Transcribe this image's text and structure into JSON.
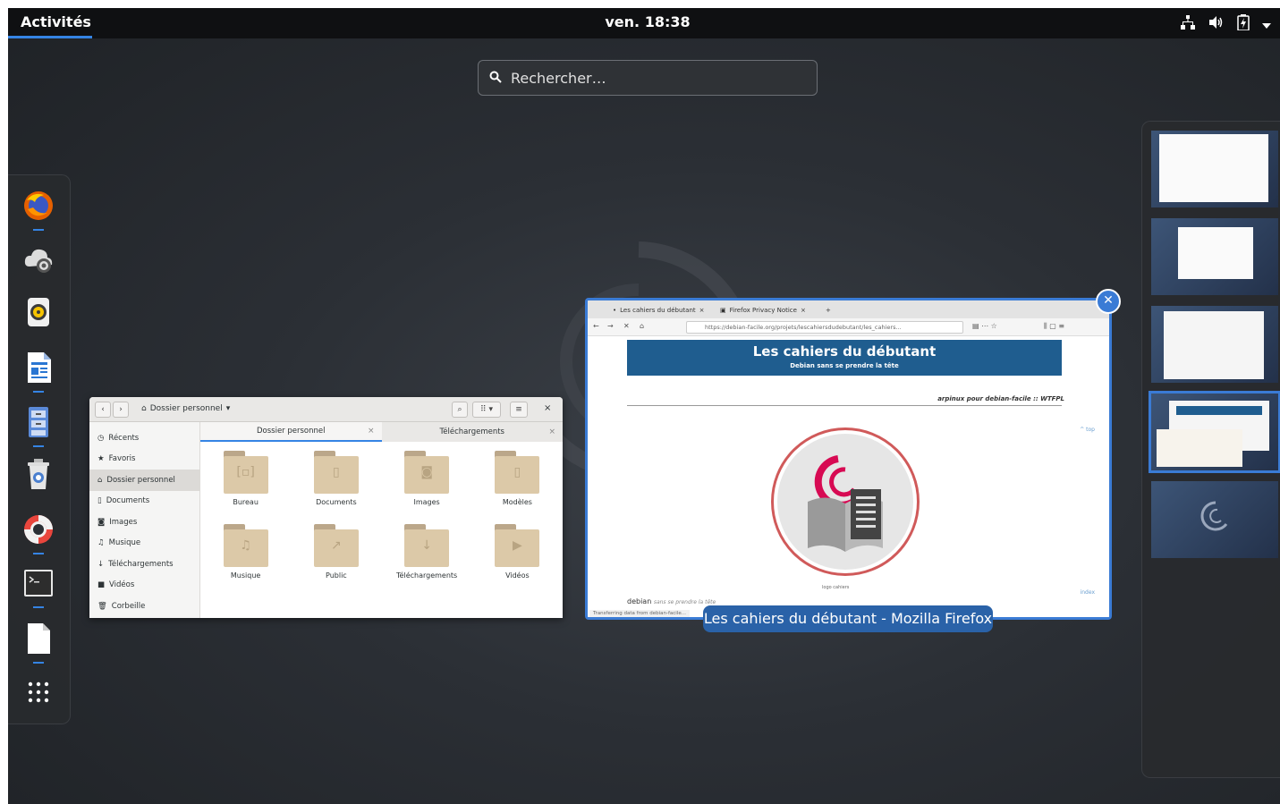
{
  "topbar": {
    "activities": "Activités",
    "clock": "ven. 18:38",
    "tray_icons": [
      "network-icon",
      "volume-icon",
      "battery-icon",
      "system-menu-arrow-icon"
    ]
  },
  "search": {
    "placeholder": "Rechercher…"
  },
  "dash": {
    "apps": [
      {
        "name": "Firefox",
        "icon": "firefox-icon",
        "running": true
      },
      {
        "name": "Software Updates",
        "icon": "software-update-icon",
        "running": false
      },
      {
        "name": "Rhythmbox",
        "icon": "rhythmbox-icon",
        "running": false
      },
      {
        "name": "LibreOffice Writer",
        "icon": "writer-icon",
        "running": true
      },
      {
        "name": "File Cabinet",
        "icon": "file-cabinet-icon",
        "running": true
      },
      {
        "name": "Trash Manager",
        "icon": "trash-app-icon",
        "running": false
      },
      {
        "name": "Help",
        "icon": "help-icon",
        "running": true
      },
      {
        "name": "Terminal",
        "icon": "terminal-icon",
        "running": true
      },
      {
        "name": "Text Editor",
        "icon": "text-editor-icon",
        "running": true
      },
      {
        "name": "Show Applications",
        "icon": "app-grid-icon",
        "running": false
      }
    ]
  },
  "files_window": {
    "location": "Dossier personnel",
    "sidebar": [
      "Récents",
      "Favoris",
      "Dossier personnel",
      "Documents",
      "Images",
      "Musique",
      "Téléchargements",
      "Vidéos",
      "Corbeille"
    ],
    "tabs": [
      "Dossier personnel",
      "Téléchargements"
    ],
    "folders": [
      "Bureau",
      "Documents",
      "Images",
      "Modèles",
      "Musique",
      "Public",
      "Téléchargements",
      "Vidéos"
    ]
  },
  "firefox_window": {
    "tabs": [
      "Les cahiers du débutant",
      "Firefox Privacy Notice"
    ],
    "url": "https://debian-facile.org/projets/lescahiersdudebutant/les_cahiers...",
    "page_title": "Les cahiers du débutant",
    "page_subtitle": "Debian sans se prendre la tête",
    "credit": "arpinux pour debian-facile :: WTFPL",
    "logo_caption": "logo cahiers",
    "link_top": "^ top",
    "link_index": "index",
    "footer_brand": "debian",
    "footer_tagline": "sans se prendre la tête",
    "status": "Transferring data from debian-facile..."
  },
  "window_caption": "Les cahiers du débutant - Mozilla Firefox",
  "workspaces": {
    "count": 5,
    "active_index": 3
  },
  "colors": {
    "accent": "#3a7bd5",
    "topbar": "#0f1012",
    "caption_bg": "#2a62a8",
    "banner": "#1f5d8f"
  }
}
